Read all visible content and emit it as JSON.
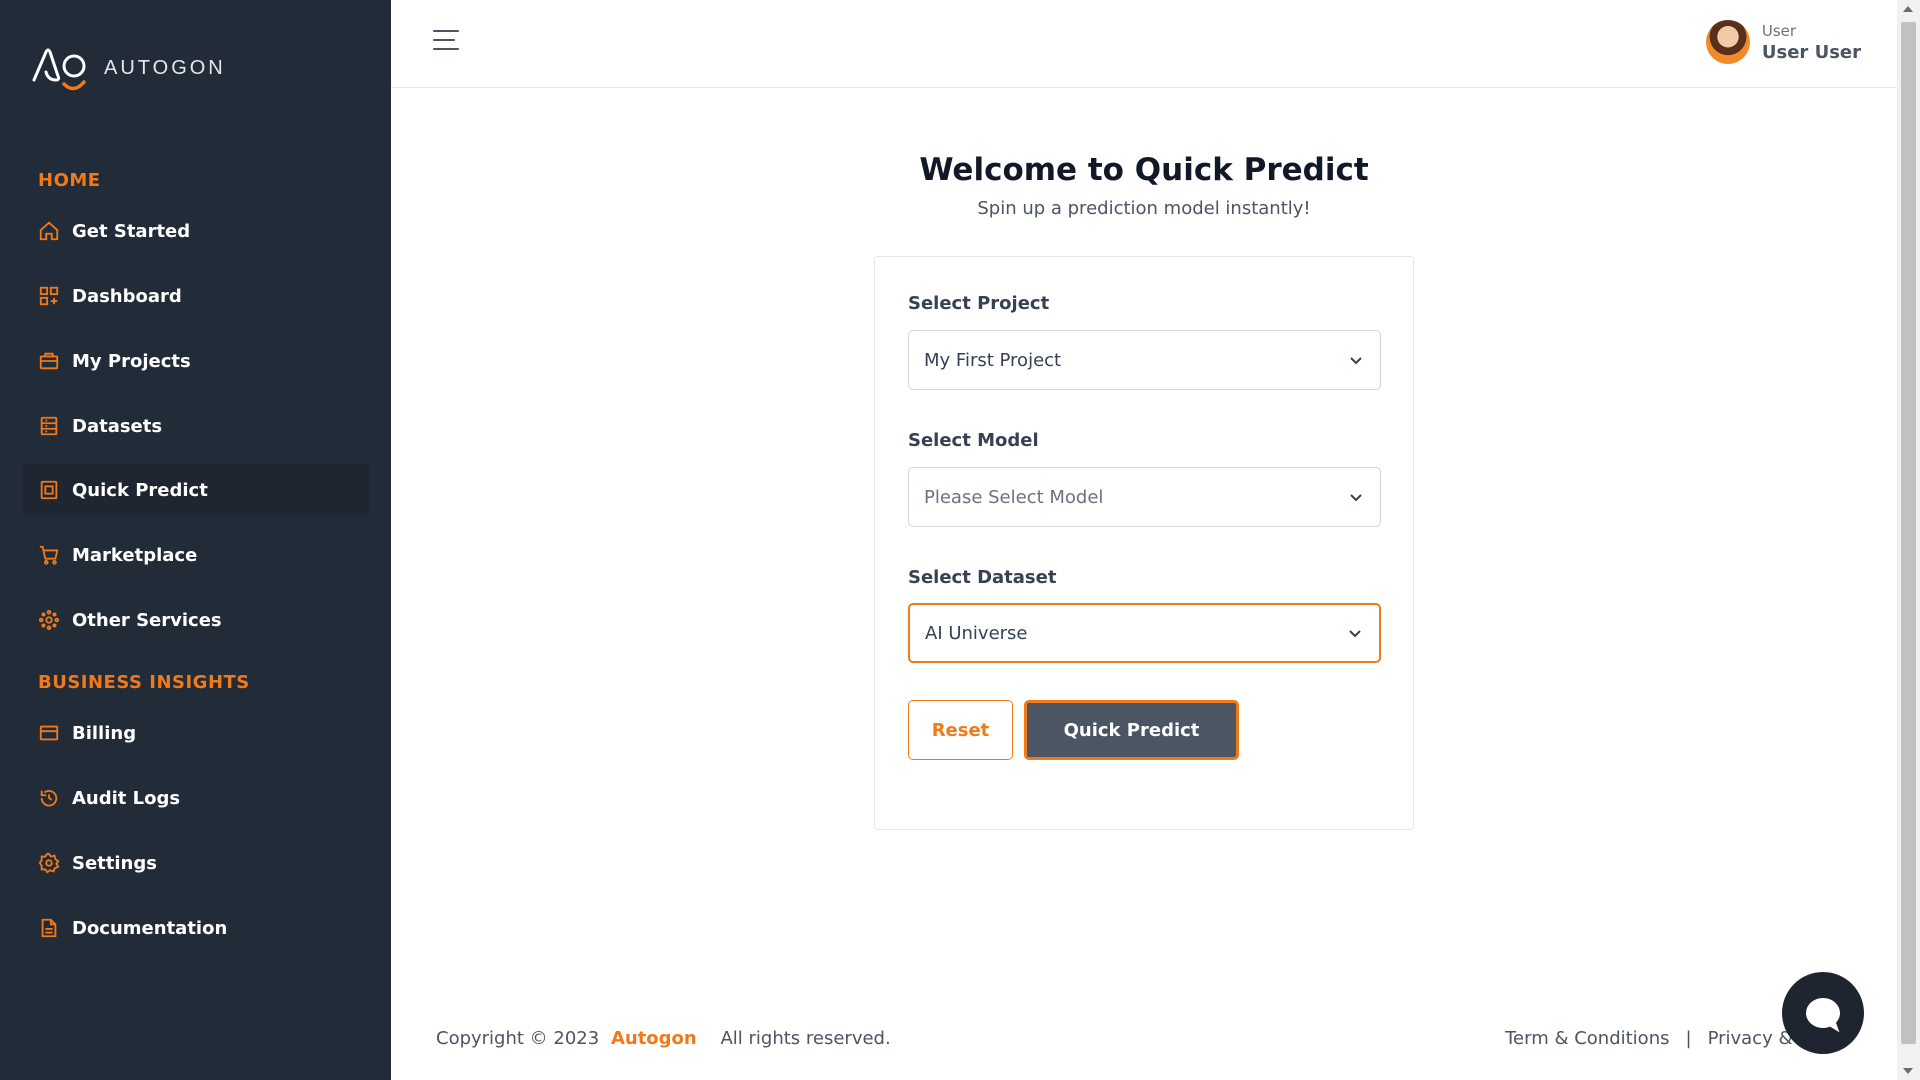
{
  "brand": {
    "name": "AUTOGON"
  },
  "sidebar": {
    "sections": [
      {
        "title": "HOME"
      },
      {
        "title": "BUSINESS INSIGHTS"
      }
    ],
    "items": [
      {
        "label": "Get Started",
        "icon": "home-icon"
      },
      {
        "label": "Dashboard",
        "icon": "dashboard-icon"
      },
      {
        "label": "My Projects",
        "icon": "briefcase-icon"
      },
      {
        "label": "Datasets",
        "icon": "dataset-icon"
      },
      {
        "label": "Quick Predict",
        "icon": "quick-predict-icon",
        "active": true
      },
      {
        "label": "Marketplace",
        "icon": "cart-icon"
      },
      {
        "label": "Other Services",
        "icon": "services-icon"
      },
      {
        "label": "Billing",
        "icon": "credit-card-icon"
      },
      {
        "label": "Audit Logs",
        "icon": "history-icon"
      },
      {
        "label": "Settings",
        "icon": "gear-icon"
      },
      {
        "label": "Documentation",
        "icon": "document-icon"
      }
    ]
  },
  "header": {
    "user_role": "User",
    "user_name": "User User"
  },
  "main": {
    "title": "Welcome to Quick Predict",
    "subtitle": "Spin up a prediction model instantly!",
    "form": {
      "project_label": "Select Project",
      "project_value": "My First Project",
      "model_label": "Select Model",
      "model_placeholder": "Please Select Model",
      "dataset_label": "Select Dataset",
      "dataset_value": "AI Universe",
      "reset_label": "Reset",
      "submit_label": "Quick Predict"
    }
  },
  "footer": {
    "copyright": "Copyright © 2023",
    "company": "Autogon",
    "rights": "All rights reserved.",
    "terms": "Term & Conditions",
    "separator": "|",
    "privacy": "Privacy & Policy"
  },
  "colors": {
    "accent": "#f07a1a",
    "sidebar_bg": "#222b38",
    "primary_button": "#4b5563"
  }
}
